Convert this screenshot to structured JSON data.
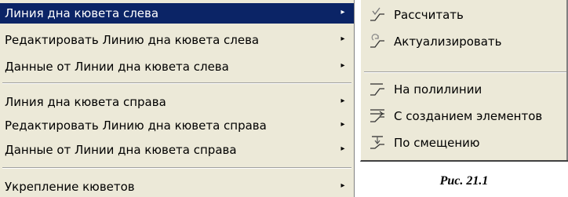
{
  "menu": {
    "items": [
      {
        "label": "Линия дна кювета слева",
        "has_submenu": true,
        "highlighted": true
      },
      {
        "label": "Редактировать Линию дна кювета слева",
        "has_submenu": true
      },
      {
        "label": "Данные от Линии дна кювета слева",
        "has_submenu": true
      },
      {
        "label": "Линия дна кювета справа",
        "has_submenu": true
      },
      {
        "label": "Редактировать Линию дна кювета справа",
        "has_submenu": true
      },
      {
        "label": "Данные от Линии дна кювета справа",
        "has_submenu": true
      },
      {
        "label": "Укрепление кюветов",
        "has_submenu": true
      }
    ],
    "arrow_glyph": "▸"
  },
  "submenu": {
    "items": [
      {
        "label": "Рассчитать",
        "icon": "calculate-line-icon"
      },
      {
        "label": "Актуализировать",
        "icon": "update-line-icon"
      },
      {
        "label": "На полилинии",
        "icon": "on-polyline-icon"
      },
      {
        "label": "С созданием элементов",
        "icon": "create-elements-icon"
      },
      {
        "label": "По смещению",
        "icon": "by-offset-icon"
      }
    ]
  },
  "caption": "Рис. 21.1",
  "colors": {
    "menu_bg": "#ece9d8",
    "highlight_bg": "#0b2466",
    "highlight_text": "#ffffff"
  }
}
